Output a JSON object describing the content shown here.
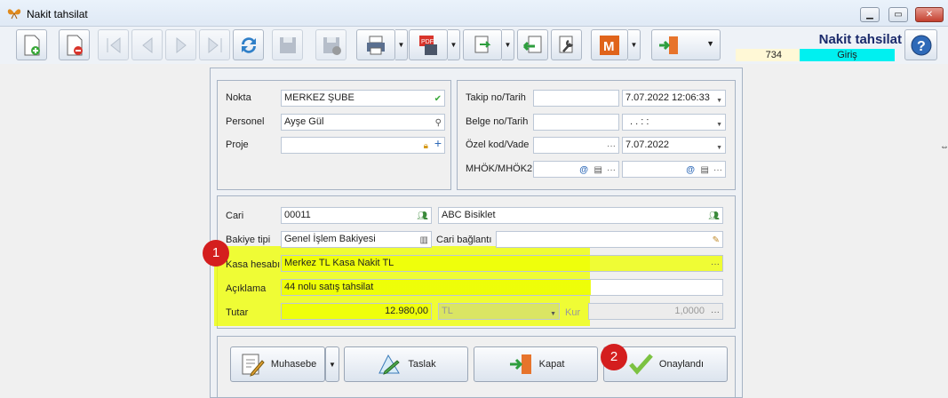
{
  "window": {
    "title": "Nakit tahsilat",
    "min": "▁",
    "max": "▭",
    "close": "✕"
  },
  "header": {
    "form_title": "Nakit tahsilat",
    "count": "734",
    "mode": "Giriş"
  },
  "left_panel": {
    "nokta": {
      "label": "Nokta",
      "value": "MERKEZ ŞUBE"
    },
    "personel": {
      "label": "Personel",
      "value": "Ayşe Gül"
    },
    "proje": {
      "label": "Proje",
      "value": ""
    }
  },
  "right_panel": {
    "takip": {
      "label": "Takip no/Tarih",
      "no": "",
      "date": "7.07.2022 12:06:33"
    },
    "belge": {
      "label": "Belge no/Tarih",
      "no": "",
      "date": ".  .      :  :"
    },
    "ozel": {
      "label": "Özel kod/Vade",
      "code": "",
      "date": "7.07.2022"
    },
    "mhok": {
      "label": "MHÖK/MHÖK2"
    }
  },
  "detail": {
    "cari": {
      "label": "Cari",
      "code": "00011",
      "name": "ABC Bisiklet"
    },
    "bakiye": {
      "label": "Bakiye tipi",
      "value": "Genel İşlem Bakiyesi"
    },
    "cari_baglanti": {
      "label": "Cari bağlantı",
      "value": ""
    },
    "kasa": {
      "label": "Kasa hesabı",
      "value": "Merkez TL Kasa Nakit TL"
    },
    "aciklama": {
      "label": "Açıklama",
      "value": "44 nolu satış tahsilat"
    },
    "tutar": {
      "label": "Tutar",
      "value": "12.980,00",
      "currency": "TL",
      "kur_label": "Kur",
      "kur": "1,0000"
    }
  },
  "buttons": {
    "muhasebe": "Muhasebe",
    "taslak": "Taslak",
    "kapat": "Kapat",
    "onay": "Onaylandı"
  },
  "badges": {
    "one": "1",
    "two": "2"
  },
  "colors": {
    "highlight": "#eeff00",
    "mode_bg": "#00f0f0",
    "badge": "#d41e1e",
    "title": "#1a2a6b"
  }
}
